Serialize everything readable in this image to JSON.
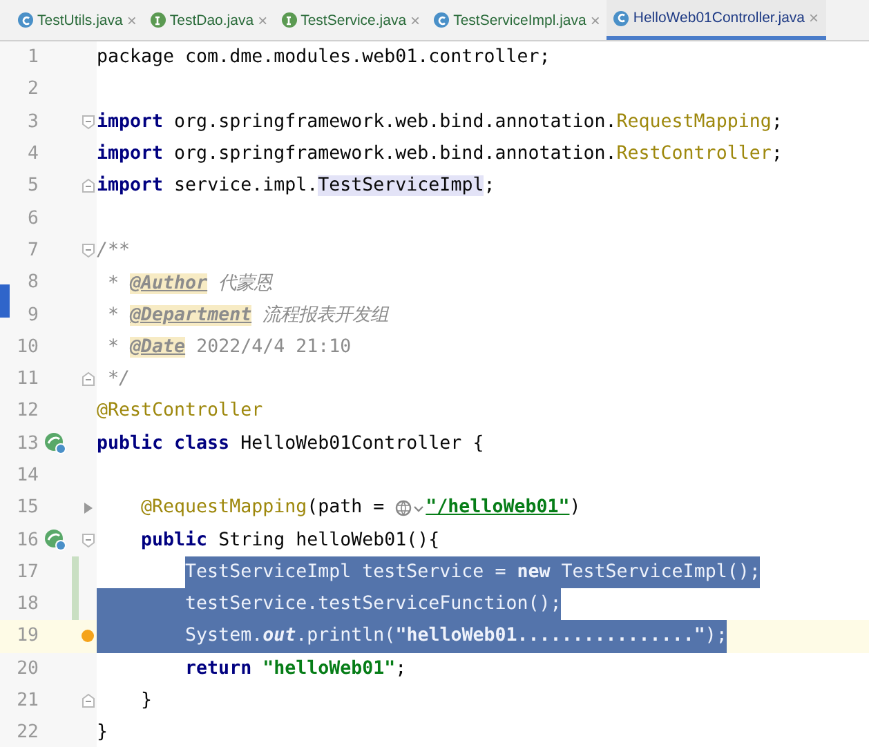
{
  "tabs": [
    {
      "label": "TestUtils.java",
      "kind": "class",
      "close": "×",
      "selected": false
    },
    {
      "label": "TestDao.java",
      "kind": "interface",
      "close": "×",
      "selected": false
    },
    {
      "label": "TestService.java",
      "kind": "interface",
      "close": "×",
      "selected": false
    },
    {
      "label": "TestServiceImpl.java",
      "kind": "class",
      "close": "×",
      "selected": false
    },
    {
      "label": "HelloWeb01Controller.java",
      "kind": "class",
      "close": "×",
      "selected": true
    }
  ],
  "lines": [
    {
      "number": "1",
      "tokens": [
        {
          "kind": "plain",
          "text": "package com.dme.modules.web01.controller;"
        }
      ]
    },
    {
      "number": "2"
    },
    {
      "number": "3",
      "fold_start": true,
      "tokens": [
        {
          "kind": "keyword",
          "text": "import "
        },
        {
          "kind": "plain",
          "text": "org.springframework.web.bind.annotation."
        },
        {
          "kind": "annotation",
          "text": "RequestMapping"
        },
        {
          "kind": "plain",
          "text": ";"
        }
      ]
    },
    {
      "number": "4",
      "tokens": [
        {
          "kind": "keyword",
          "text": "import "
        },
        {
          "kind": "plain",
          "text": "org.springframework.web.bind.annotation."
        },
        {
          "kind": "annotation",
          "text": "RestController"
        },
        {
          "kind": "plain",
          "text": ";"
        }
      ]
    },
    {
      "number": "5",
      "fold_end": true,
      "tokens": [
        {
          "kind": "keyword",
          "text": "import "
        },
        {
          "kind": "plain",
          "text": "service.impl."
        },
        {
          "kind": "marked",
          "text": "TestServiceImpl"
        },
        {
          "kind": "plain",
          "text": ";"
        }
      ]
    },
    {
      "number": "6"
    },
    {
      "number": "7",
      "fold_start": true,
      "tokens": [
        {
          "kind": "comment",
          "text": "/**"
        }
      ]
    },
    {
      "number": "8",
      "tokens": [
        {
          "kind": "comment",
          "text": " * "
        },
        {
          "kind": "doctag",
          "text": "@Author"
        },
        {
          "kind": "comment",
          "text": " 代蒙恩"
        }
      ]
    },
    {
      "number": "9",
      "tokens": [
        {
          "kind": "comment",
          "text": " * "
        },
        {
          "kind": "doctag",
          "text": "@Department"
        },
        {
          "kind": "comment",
          "text": " 流程报表开发组"
        }
      ]
    },
    {
      "number": "10",
      "tokens": [
        {
          "kind": "comment",
          "text": " * "
        },
        {
          "kind": "doctag",
          "text": "@Date"
        },
        {
          "kind": "docvalue",
          "text": " 2022/4/4 21:10"
        }
      ]
    },
    {
      "number": "11",
      "fold_end": true,
      "tokens": [
        {
          "kind": "comment",
          "text": " */"
        }
      ]
    },
    {
      "number": "12",
      "tokens": [
        {
          "kind": "annotation",
          "text": "@RestController"
        }
      ]
    },
    {
      "number": "13",
      "bean": true,
      "tokens": [
        {
          "kind": "keyword",
          "text": "public class "
        },
        {
          "kind": "plain",
          "text": "HelloWeb01Controller {"
        }
      ]
    },
    {
      "number": "14"
    },
    {
      "number": "15",
      "fold_arrow": true,
      "tokens": [
        {
          "kind": "annotation",
          "text": "    @RequestMapping"
        },
        {
          "kind": "plain",
          "text": "(path = "
        },
        {
          "kind": "globe"
        },
        {
          "kind": "link",
          "text": "\"/helloWeb01\""
        },
        {
          "kind": "plain",
          "text": ")"
        }
      ]
    },
    {
      "number": "16",
      "bean": true,
      "fold_start": true,
      "tokens": [
        {
          "kind": "keyword",
          "text": "    public "
        },
        {
          "kind": "plain",
          "text": "String helloWeb01(){"
        }
      ]
    },
    {
      "number": "17",
      "changed": true,
      "selected": true,
      "selection_partial": true,
      "tokens": [
        {
          "kind": "plain",
          "text": "        TestServiceImpl testService = "
        },
        {
          "kind": "keyword",
          "text": "new "
        },
        {
          "kind": "plain",
          "text": "TestServiceImpl();"
        }
      ]
    },
    {
      "number": "18",
      "changed": true,
      "selected": true,
      "selection_partial": false,
      "tokens": [
        {
          "kind": "plain",
          "text": "        testService.testServiceFunction();"
        }
      ]
    },
    {
      "number": "19",
      "current": true,
      "hint_dot": true,
      "selected": true,
      "selection_partial": false,
      "tokens": [
        {
          "kind": "plain",
          "text": "        System."
        },
        {
          "kind": "static",
          "text": "out"
        },
        {
          "kind": "plain",
          "text": ".println("
        },
        {
          "kind": "string",
          "text": "\"helloWeb01................\""
        },
        {
          "kind": "plain",
          "text": ");"
        }
      ]
    },
    {
      "number": "20",
      "tokens": [
        {
          "kind": "keyword",
          "text": "        return "
        },
        {
          "kind": "string",
          "text": "\"helloWeb01\""
        },
        {
          "kind": "plain",
          "text": ";"
        }
      ]
    },
    {
      "number": "21",
      "fold_end": true,
      "tokens": [
        {
          "kind": "plain",
          "text": "    }"
        }
      ]
    },
    {
      "number": "22",
      "tokens": [
        {
          "kind": "plain",
          "text": "}"
        }
      ]
    }
  ]
}
